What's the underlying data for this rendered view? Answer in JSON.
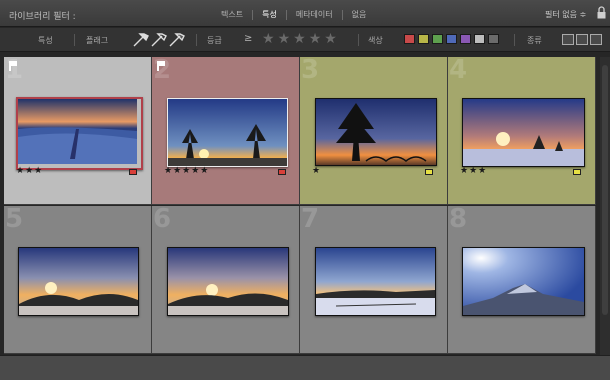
{
  "filter_bar": {
    "title": "라이브러리 필터 :",
    "tabs": [
      {
        "label": "텍스트",
        "active": false
      },
      {
        "label": "특성",
        "active": true
      },
      {
        "label": "메타데이터",
        "active": false
      },
      {
        "label": "없음",
        "active": false
      }
    ],
    "preset": "필터 없음 ≑",
    "lock_icon": "lock-icon"
  },
  "attribute_bar": {
    "attribute_label": "특성",
    "flag_label": "플래그",
    "rating_label": "등급",
    "rating_op": "≥",
    "color_label": "색상",
    "kind_label": "종류",
    "colors": [
      "#c94a4a",
      "#b8b648",
      "#5ea04e",
      "#4f69b8",
      "#8a58b4",
      "#bdbdbd",
      "#6b6b6b"
    ]
  },
  "thumbnails": [
    {
      "num": "1",
      "stars": "★★★",
      "label_color": "#d8403a",
      "cell_bg": "#bdbdbd",
      "selected": true,
      "flag": true
    },
    {
      "num": "2",
      "stars": "★★★★★",
      "label_color": "#d8403a",
      "cell_bg": "#a77a7a",
      "selected": true,
      "flag": true
    },
    {
      "num": "3",
      "stars": "★",
      "label_color": "#e6e044",
      "cell_bg": "#a4a76c",
      "selected": false,
      "flag": false
    },
    {
      "num": "4",
      "stars": "★★★",
      "label_color": "#e6e044",
      "cell_bg": "#a4a76c",
      "selected": false,
      "flag": false
    },
    {
      "num": "5",
      "stars": "",
      "label_color": "",
      "cell_bg": "#858585",
      "selected": false,
      "flag": false
    },
    {
      "num": "6",
      "stars": "",
      "label_color": "",
      "cell_bg": "#858585",
      "selected": false,
      "flag": false
    },
    {
      "num": "7",
      "stars": "",
      "label_color": "",
      "cell_bg": "#858585",
      "selected": false,
      "flag": false
    },
    {
      "num": "8",
      "stars": "",
      "label_color": "",
      "cell_bg": "#858585",
      "selected": false,
      "flag": false
    }
  ]
}
